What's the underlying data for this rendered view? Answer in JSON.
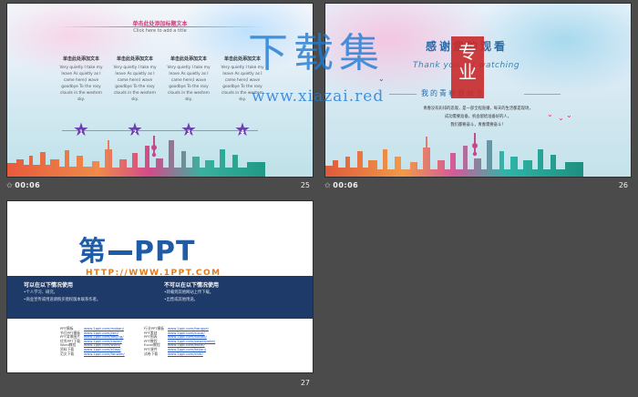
{
  "slides": [
    {
      "id": "slide-25",
      "duration": "00:06",
      "number": "25",
      "title": "单击此处添加标题文本",
      "subtitle": "Click here to add a title",
      "columns": [
        {
          "heading": "单击此处添加文本",
          "body": "Very quietly I take my leave As quietly as I came here;I wave goodbye To the rosy clouds in the western sky."
        },
        {
          "heading": "单击此处添加文本",
          "body": "Very quietly I take my leave As quietly as I came here;I wave goodbye To the rosy clouds in the western sky."
        },
        {
          "heading": "单击此处添加文本",
          "body": "Very quietly I take my leave As quietly as I came here;I wave goodbye To the rosy clouds in the western sky."
        },
        {
          "heading": "单击此处添加文本",
          "body": "Very quietly I take my leave As quietly as I came here;I wave goodbye To the rosy clouds in the western sky."
        }
      ],
      "steps": [
        "1",
        "2",
        "3",
        "4"
      ]
    },
    {
      "id": "slide-26",
      "duration": "00:06",
      "number": "26",
      "thanks_cn": "感谢您的观看",
      "thanks_en": "Thank you for watching",
      "motto": "我的青春我做主",
      "body_lines": [
        "青春没有彩排的悲观，是一部全程直播，每天的生活都是现场，",
        "成功需要准备，机会留给准备好的人，",
        "我们都要奋斗，青春需要奋斗！"
      ]
    },
    {
      "id": "slide-27",
      "number": "27",
      "logo_text_left": "第",
      "logo_text_right": "PPT",
      "logo_url": "HTTP://WWW.1PPT.COM",
      "left_heading": "可以在以下情况使用",
      "left_lines": [
        "•个人学习、研究。",
        "•商业宣传或用途请购买授权版本联系作者。"
      ],
      "right_heading": "不可以在以下情况使用",
      "right_lines": [
        "•转载到其他网站上传下载。",
        "•出售或其他用途。"
      ],
      "links_left": [
        {
          "label": "PPT模板",
          "url": "www.1ppt.com/moban/"
        },
        {
          "label": "节日PPT模板",
          "url": "www.1ppt.com/jieri/"
        },
        {
          "label": "PPT背景图片",
          "url": "www.1ppt.com/beijing/"
        },
        {
          "label": "优秀PPT下载",
          "url": "www.1ppt.com/xiazai/"
        },
        {
          "label": "Word教程",
          "url": "www.1ppt.com/word/"
        },
        {
          "label": "资料下载",
          "url": "www.1ppt.com/ziliao/"
        },
        {
          "label": "范文下载",
          "url": "www.1ppt.com/fanwen/"
        }
      ],
      "links_right": [
        {
          "label": "行业PPT模板",
          "url": "www.1ppt.com/hangye/"
        },
        {
          "label": "PPT素材",
          "url": "www.1ppt.com/sucai/"
        },
        {
          "label": "PPT图表",
          "url": "www.1ppt.com/tubiao/"
        },
        {
          "label": "PPT教程",
          "url": "www.1ppt.com/powerpoint/"
        },
        {
          "label": "Excel教程",
          "url": "www.1ppt.com/excel/"
        },
        {
          "label": "PPT课件",
          "url": "www.1ppt.com/kejian/"
        },
        {
          "label": "试卷下载",
          "url": "www.1ppt.com/shiti/"
        }
      ]
    }
  ],
  "watermark": {
    "cn_left": "下载集",
    "seal": "专业",
    "url": "www.xiazai.red"
  }
}
